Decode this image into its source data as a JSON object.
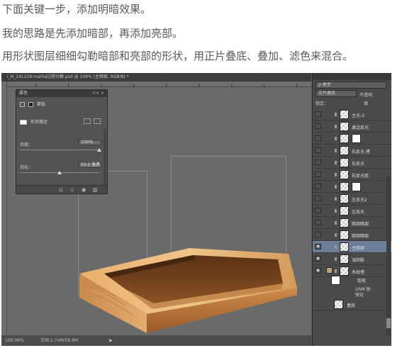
{
  "intro": {
    "line1": "下面关键一步，添加明暗效果。",
    "line2": "我的思路是先添加暗部，再添加亮部。",
    "line3": "用形状图层细细勾勒暗部和亮部的形状，用正片叠底、叠加、滤色来混合。"
  },
  "ps": {
    "tab_title": "i_N_141229-maihd过程分解.psd @ 109% (主暗部, RGB/8) *",
    "status": {
      "zoom": "109.09%",
      "doc": "文档:1.74M/58.9M",
      "arrow": "▶"
    },
    "properties": {
      "title": "属性",
      "header_controls": "<< ×",
      "tab_label": "蒙版",
      "shape_label": "形状路径",
      "density_label": "浓度：",
      "density_value": "100%",
      "density_fraction": 1.0,
      "feather_label": "羽化：",
      "feather_value": "50.0 像素",
      "feather_fraction": 0.5,
      "icons": [
        "mask-select-icon",
        "apply-mask-icon",
        "eye-icon",
        "delete-icon"
      ]
    },
    "layers": {
      "kind_label": "ρ 类型",
      "blend_mode": "正片叠底",
      "opacity_label": "不透明",
      "lock_label": "锁定：",
      "fill_label": "填",
      "rows": [
        {
          "name": "主光-2",
          "visible": false,
          "mask": false,
          "active": false
        },
        {
          "name": "桌边反光",
          "visible": false,
          "mask": false,
          "active": false
        },
        {
          "name": "",
          "visible": false,
          "mask": true,
          "active": false
        },
        {
          "name": "右反光 拷",
          "visible": false,
          "mask": false,
          "active": false
        },
        {
          "name": "右反光",
          "visible": false,
          "mask": false,
          "active": false
        },
        {
          "name": "右反光底",
          "visible": false,
          "mask": false,
          "active": false
        },
        {
          "name": "",
          "visible": false,
          "mask": true,
          "active": false
        },
        {
          "name": "左反光2",
          "visible": false,
          "mask": false,
          "active": false
        },
        {
          "name": "左反光",
          "visible": false,
          "mask": false,
          "active": false
        },
        {
          "name": "暗部暗部",
          "visible": false,
          "mask": false,
          "active": false
        },
        {
          "name": "暗部暗部",
          "visible": false,
          "mask": false,
          "active": false
        },
        {
          "name": "主暗部",
          "visible": true,
          "mask": false,
          "active": true
        },
        {
          "name": "浅阴影",
          "visible": true,
          "mask": false,
          "active": false
        },
        {
          "name": "木纹理",
          "visible": true,
          "mask": false,
          "active": false
        }
      ],
      "smart_filter": {
        "label": "智能",
        "items": [
          "USM 锐",
          "锐化"
        ]
      },
      "bottom_layer": "盒底"
    }
  }
}
